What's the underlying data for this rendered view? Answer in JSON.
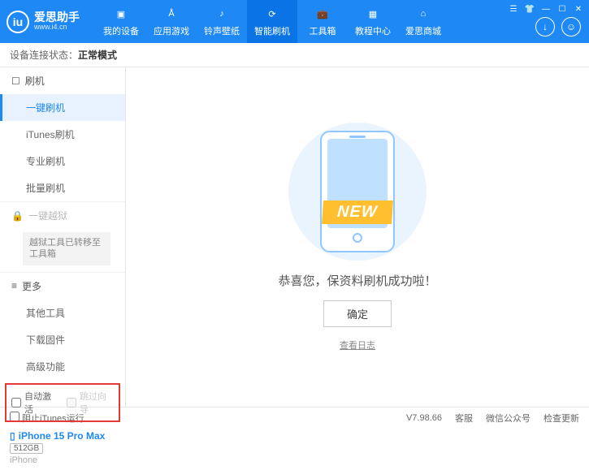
{
  "header": {
    "logo_title": "爱思助手",
    "logo_sub": "www.i4.cn",
    "tabs": [
      "我的设备",
      "应用游戏",
      "铃声壁纸",
      "智能刷机",
      "工具箱",
      "教程中心",
      "爱思商城"
    ],
    "active_tab_index": 3
  },
  "status": {
    "label": "设备连接状态：",
    "value": "正常模式"
  },
  "sidebar": {
    "flash_head": "刷机",
    "flash_items": [
      "一键刷机",
      "iTunes刷机",
      "专业刷机",
      "批量刷机"
    ],
    "flash_active_index": 0,
    "jailbreak_head": "一键越狱",
    "jailbreak_note": "越狱工具已转移至工具箱",
    "more_head": "更多",
    "more_items": [
      "其他工具",
      "下载固件",
      "高级功能"
    ],
    "checkbox1": "自动激活",
    "checkbox2": "跳过向导",
    "device_name": "iPhone 15 Pro Max",
    "device_storage": "512GB",
    "device_type": "iPhone"
  },
  "main": {
    "new_badge": "NEW",
    "success_msg": "恭喜您，保资料刷机成功啦！",
    "ok_button": "确定",
    "log_link": "查看日志"
  },
  "footer": {
    "block_itunes": "阻止iTunes运行",
    "version": "V7.98.66",
    "links": [
      "客服",
      "微信公众号",
      "检查更新"
    ]
  }
}
